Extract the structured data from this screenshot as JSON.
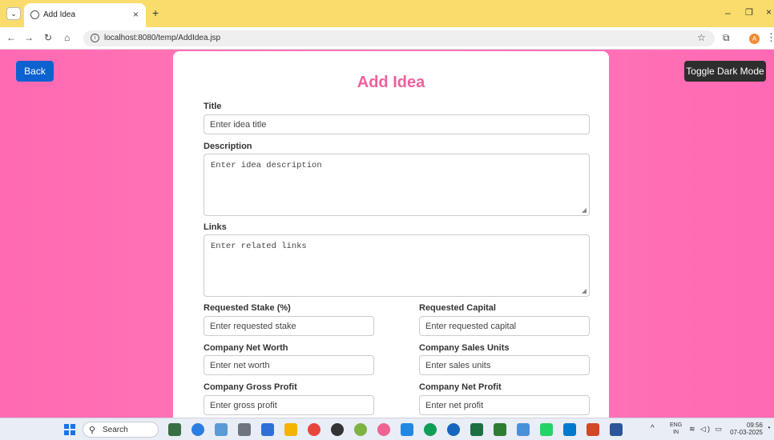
{
  "browser": {
    "tab_title": "Add Idea",
    "tab_close": "×",
    "new_tab": "+",
    "url": "localhost:8080/temp/AddIdea.jsp",
    "profile_initial": "A",
    "menu_glyph": "⌄",
    "back_glyph": "←",
    "forward_glyph": "→",
    "reload_glyph": "↻",
    "home_glyph": "⌂",
    "star_glyph": "☆",
    "ext_glyph": "⧉",
    "kebab_glyph": "⋮",
    "minimize_glyph": "–",
    "maximize_glyph": "❐",
    "close_glyph": "×"
  },
  "page": {
    "back_label": "Back",
    "dark_mode_label": "Toggle Dark Mode",
    "form_title": "Add Idea",
    "fields": {
      "title": {
        "label": "Title",
        "placeholder": "Enter idea title"
      },
      "description": {
        "label": "Description",
        "placeholder": "Enter idea description"
      },
      "links": {
        "label": "Links",
        "placeholder": "Enter related links"
      },
      "stake": {
        "label": "Requested Stake (%)",
        "placeholder": "Enter requested stake"
      },
      "capital": {
        "label": "Requested Capital",
        "placeholder": "Enter requested capital"
      },
      "net_worth": {
        "label": "Company Net Worth",
        "placeholder": "Enter net worth"
      },
      "sales_units": {
        "label": "Company Sales Units",
        "placeholder": "Enter sales units"
      },
      "gross_profit": {
        "label": "Company Gross Profit",
        "placeholder": "Enter gross profit"
      },
      "net_profit": {
        "label": "Company Net Profit",
        "placeholder": "Enter net profit"
      }
    },
    "colors": {
      "accent": "#f0609e",
      "back_button": "#0d62d0",
      "dark_button": "#2e2e2e",
      "background": "#ff6fb5"
    }
  },
  "taskbar": {
    "search_label": "Search",
    "search_glyph": "⚲",
    "caret_glyph": "^",
    "lang_top": "ENG",
    "lang_bottom": "IN",
    "sys_icons": "≋ ◁) ▭",
    "time": "09:56",
    "date": "07-03-2025",
    "bell_glyph": "◔",
    "icons": [
      "widgets-icon",
      "copilot-icon",
      "photos-icon",
      "settings-icon",
      "store-icon",
      "file-explorer-icon",
      "chrome-icon",
      "obs-icon",
      "chrome-profile-icon",
      "chrome-dev-icon",
      "terminal-icon",
      "edge-icon",
      "chrome-canary-icon",
      "excel-icon",
      "spotify-icon",
      "screen-icon",
      "whatsapp-icon",
      "vscode-icon",
      "powerpoint-icon",
      "word-icon"
    ],
    "icon_colors": [
      "#3a6e44",
      "#2a7de1",
      "#5b9bd5",
      "#6c757d",
      "#2f6fd6",
      "#f4b400",
      "#e8453c",
      "#333333",
      "#7cb342",
      "#f06292",
      "#1e88e5",
      "#0f9d58",
      "#1565c0",
      "#1d6f42",
      "#2e7d32",
      "#4a90d9",
      "#25d366",
      "#007acc",
      "#d24726",
      "#2b579a"
    ]
  }
}
